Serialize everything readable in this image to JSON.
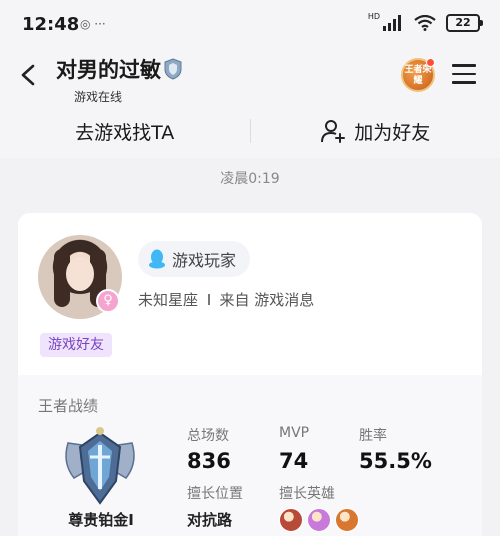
{
  "status_bar": {
    "time": "12:48",
    "left_icons": "◎ ···",
    "network_label": "HD",
    "battery": "22",
    "icons": [
      "signal-icon",
      "wifi-icon",
      "battery-icon"
    ]
  },
  "header": {
    "title": "对男的过敏",
    "subtitle": "游戏在线",
    "game_logo_text": "王者荣耀",
    "icons": [
      "back-icon",
      "shield-verified-icon",
      "game-logo-icon",
      "menu-icon"
    ]
  },
  "actions": {
    "find_game": "去游戏找TA",
    "add_friend": "加为好友"
  },
  "timestamp": "凌晨0:19",
  "profile": {
    "player_tag": "游戏玩家",
    "zodiac": "未知星座",
    "source": "来自 游戏消息",
    "friend_badge": "游戏好友",
    "gender_symbol": "♀"
  },
  "stats": {
    "title": "王者战绩",
    "rank": "尊贵铂金I",
    "total_label": "总场数",
    "total_value": "836",
    "mvp_label": "MVP",
    "mvp_value": "74",
    "winrate_label": "胜率",
    "winrate_value": "55.5%",
    "position_label": "擅长位置",
    "position_value": "对抗路",
    "heroes_label": "擅长英雄",
    "hero_colors": [
      "#b84a3a",
      "#c77ad9",
      "#d9762f"
    ]
  },
  "colors": {
    "background": "#f2f2f5",
    "accent_purple": "#7a45c5",
    "badge_bg": "#efe4fb",
    "tag_icon": "#3fb8f5"
  }
}
